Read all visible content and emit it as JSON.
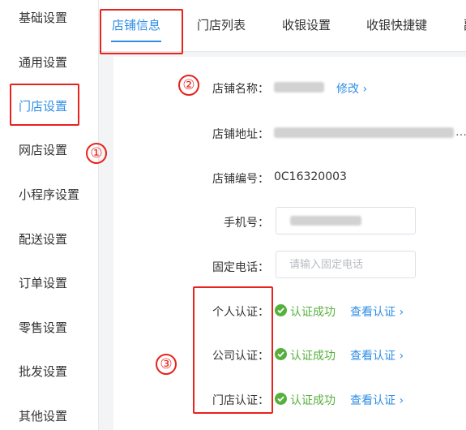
{
  "sidebar": {
    "items": [
      {
        "label": "基础设置"
      },
      {
        "label": "通用设置"
      },
      {
        "label": "门店设置"
      },
      {
        "label": "网店设置"
      },
      {
        "label": "小程序设置"
      },
      {
        "label": "配送设置"
      },
      {
        "label": "订单设置"
      },
      {
        "label": "零售设置"
      },
      {
        "label": "批发设置"
      },
      {
        "label": "其他设置"
      }
    ],
    "active_index": 2
  },
  "tabs": {
    "items": [
      {
        "label": "店铺信息"
      },
      {
        "label": "门店列表"
      },
      {
        "label": "收银设置"
      },
      {
        "label": "收银快捷键"
      },
      {
        "label": "副"
      }
    ],
    "active_index": 0
  },
  "store": {
    "name_label": "店铺名称：",
    "edit_link": "修改",
    "address_label": "店铺地址：",
    "address_suffix": "…",
    "code_label": "店铺编号：",
    "code_value": "0C16320003",
    "phone_label": "手机号：",
    "landline_label": "固定电话：",
    "landline_placeholder": "请输入固定电话"
  },
  "certifications": [
    {
      "label": "个人认证：",
      "status": "认证成功",
      "link": "查看认证"
    },
    {
      "label": "公司认证：",
      "status": "认证成功",
      "link": "查看认证"
    },
    {
      "label": "门店认证：",
      "status": "认证成功",
      "link": "查看认证"
    }
  ],
  "annotations": {
    "marker_1": "①",
    "marker_2": "②",
    "marker_3": "③"
  },
  "colors": {
    "accent": "#2f8ee6",
    "success": "#57b03d",
    "annotation": "#e8221c"
  }
}
